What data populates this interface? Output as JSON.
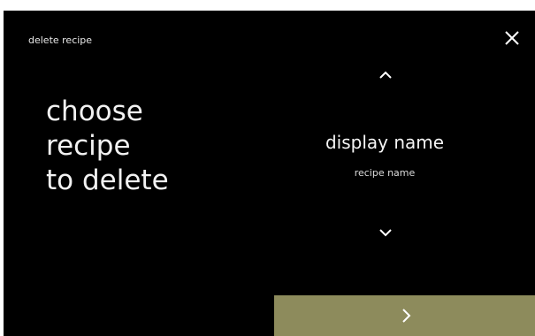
{
  "screen": {
    "title": "delete recipe",
    "close_icon": "close-icon",
    "prompt_lines": [
      "choose",
      "recipe",
      "to delete"
    ]
  },
  "selector": {
    "up_icon": "chevron-up-icon",
    "display_name": "display name",
    "recipe_name": "recipe name",
    "down_icon": "chevron-down-icon"
  },
  "footer": {
    "next_icon": "chevron-right-icon",
    "next_color": "#8d8b5c"
  },
  "colors": {
    "background": "#000000",
    "text": "#ffffff",
    "accent": "#8d8b5c"
  }
}
